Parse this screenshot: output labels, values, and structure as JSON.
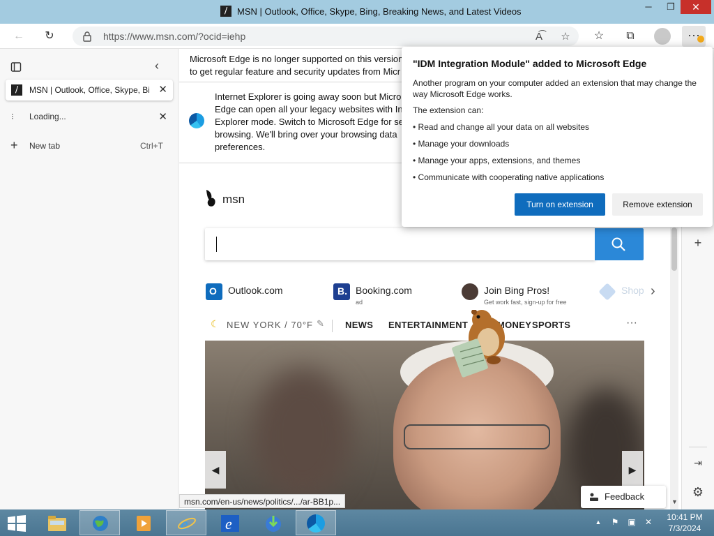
{
  "window": {
    "title": "MSN | Outlook, Office, Skype, Bing, Breaking News, and Latest Videos"
  },
  "address_bar": {
    "url": "https://www.msn.com/?ocid=iehp"
  },
  "tabs": [
    {
      "title": "MSN | Outlook, Office, Skype, Bing, Breaking News, and Latest Videos",
      "state": "active"
    },
    {
      "title": "Loading...",
      "state": "loading"
    }
  ],
  "new_tab": {
    "label": "New tab",
    "shortcut": "Ctrl+T"
  },
  "notices": {
    "edge_unsupported": [
      "Microsoft Edge is no longer supported on this version",
      "to get regular feature and security updates from Micr"
    ],
    "ie_retiring": [
      "Internet Explorer is going away soon but Micro",
      "Edge can open all your legacy websites with Int",
      "Explorer mode. Switch to Microsoft Edge for se",
      "browsing. We'll bring over your browsing data",
      "preferences."
    ]
  },
  "msn": {
    "logo": "msn",
    "quick_links": [
      {
        "label": "Outlook.com",
        "sub": "",
        "icon": "outlook-icon",
        "color": "#0f6cbd"
      },
      {
        "label": "Booking.com",
        "sub": "ad",
        "icon": "booking-icon",
        "color": "#1e3f91"
      },
      {
        "label": "Join Bing Pros!",
        "sub": "Get work fast, sign-up for free",
        "icon": "bing-pros-avatar",
        "color": "#4b3b35"
      },
      {
        "label": "Shop",
        "sub": "",
        "icon": "shop-icon",
        "color": "#c8dbf2"
      }
    ],
    "weather": "NEW YORK / 70°F",
    "nav": [
      "NEWS",
      "ENTERTAINMENT",
      "MONEY",
      "SPORTS"
    ],
    "feedback": "Feedback"
  },
  "status_url": "msn.com/en-us/news/politics/.../ar-BB1p...",
  "extension_popup": {
    "title": "\"IDM Integration Module\" added to Microsoft Edge",
    "description": "Another program on your computer added an extension that may change the way Microsoft Edge works.",
    "can_label": "The extension can:",
    "permissions": [
      "• Read and change all your data on all websites",
      "• Manage your downloads",
      "• Manage your apps, extensions, and themes",
      "• Communicate with cooperating native applications"
    ],
    "primary_button": "Turn on extension",
    "secondary_button": "Remove extension"
  },
  "clock": {
    "time": "10:41 PM",
    "date": "7/3/2024"
  },
  "colors": {
    "accent": "#0f6cbd",
    "search_button": "#2b88d8",
    "close_button": "#c7302a",
    "taskbar": "#4a7591"
  }
}
